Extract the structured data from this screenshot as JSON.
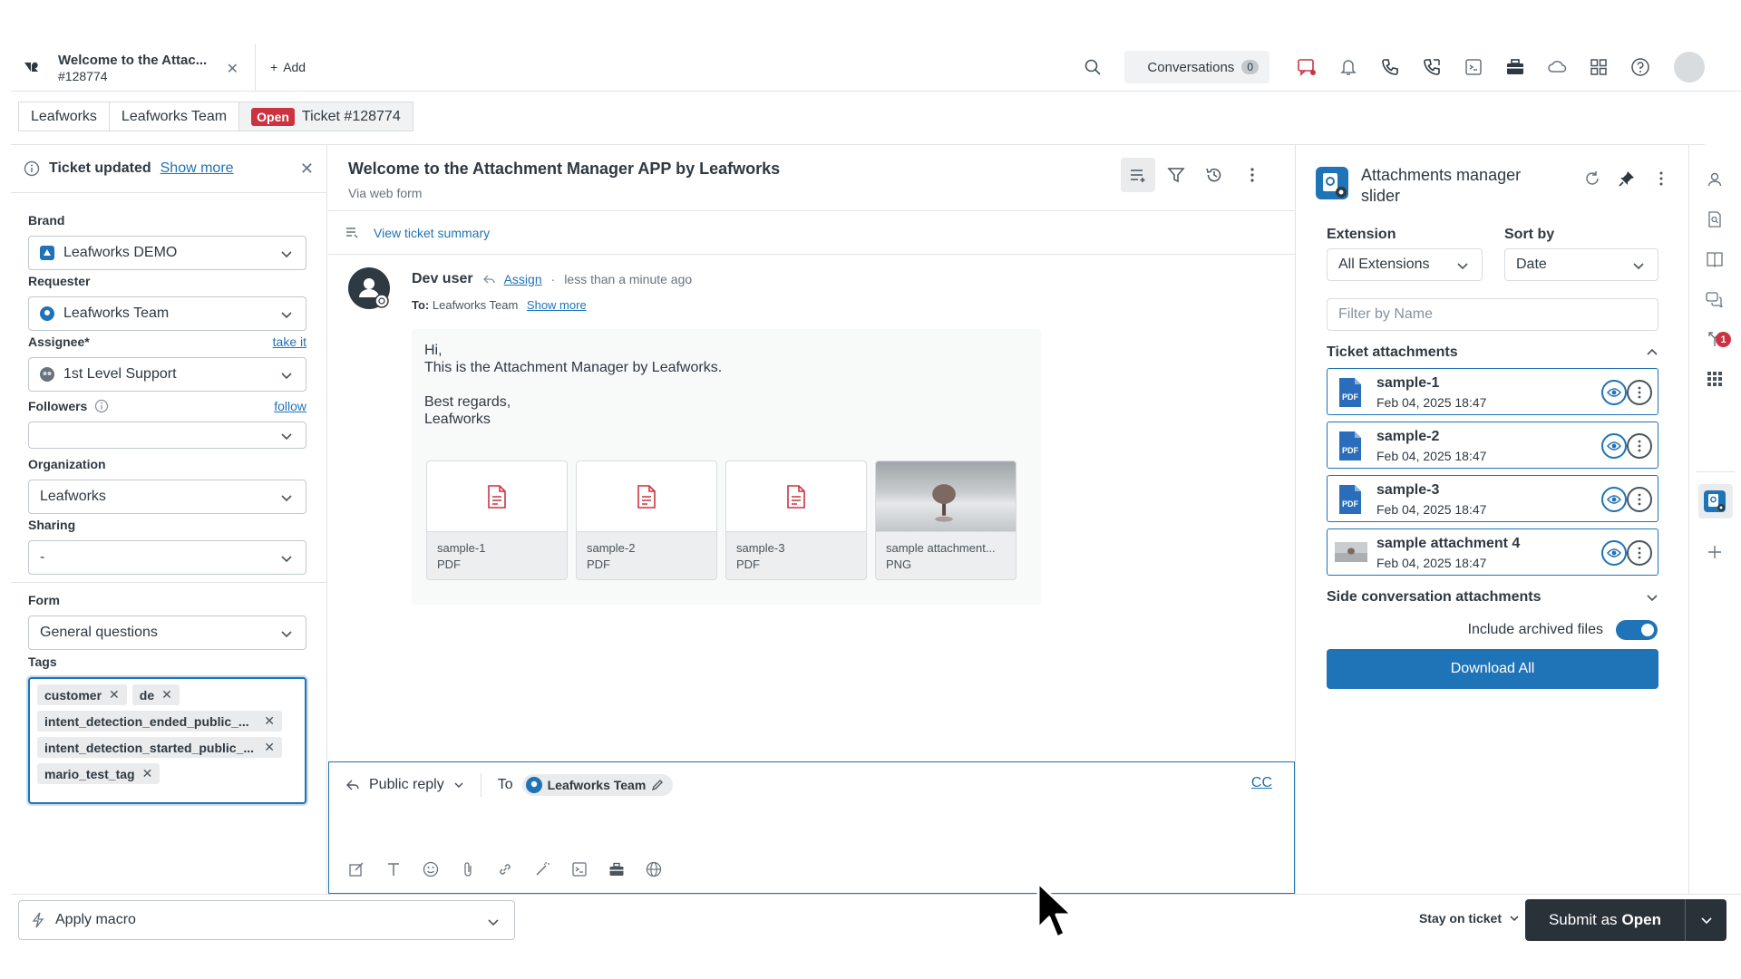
{
  "tab": {
    "title": "Welcome to the Attac...",
    "subtitle": "#128774",
    "add_label": "Add"
  },
  "topbar": {
    "conversations_label": "Conversations",
    "conversations_count": "0"
  },
  "breadcrumb": {
    "items": [
      "Leafworks",
      "Leafworks Team"
    ],
    "status": "Open",
    "ticket": "Ticket #128774"
  },
  "notice": {
    "text": "Ticket updated",
    "link": "Show more"
  },
  "fields": {
    "brand": {
      "label": "Brand",
      "value": "Leafworks DEMO"
    },
    "requester": {
      "label": "Requester",
      "value": "Leafworks Team"
    },
    "assignee": {
      "label": "Assignee*",
      "action": "take it",
      "value": "1st Level Support"
    },
    "followers": {
      "label": "Followers",
      "action": "follow",
      "value": ""
    },
    "organization": {
      "label": "Organization",
      "value": "Leafworks"
    },
    "sharing": {
      "label": "Sharing",
      "value": "-"
    },
    "form": {
      "label": "Form",
      "value": "General questions"
    },
    "tags": {
      "label": "Tags",
      "items": [
        "customer",
        "de",
        "intent_detection_ended_public_...",
        "intent_detection_started_public_...",
        "mario_test_tag"
      ]
    }
  },
  "bottom": {
    "macro_label": "Apply macro",
    "stay_label": "Stay on ticket",
    "submit_prefix": "Submit as",
    "submit_status": "Open"
  },
  "conversation": {
    "title": "Welcome to the Attachment Manager APP by Leafworks",
    "channel": "Via web form",
    "summary_link": "View ticket summary",
    "message": {
      "author": "Dev user",
      "assign": "Assign",
      "time": "less than a minute ago",
      "to_label": "To:",
      "to_value": "Leafworks Team",
      "show_more": "Show more",
      "lines": [
        "Hi,",
        "This is the Attachment Manager by Leafworks.",
        "",
        "Best regards,",
        "Leafworks"
      ],
      "attachments": [
        {
          "name": "sample-1",
          "type": "PDF"
        },
        {
          "name": "sample-2",
          "type": "PDF"
        },
        {
          "name": "sample-3",
          "type": "PDF"
        },
        {
          "name": "sample attachment...",
          "type": "PNG"
        }
      ]
    }
  },
  "composer": {
    "reply_type": "Public reply",
    "to_label": "To",
    "recipient": "Leafworks Team",
    "cc_label": "CC"
  },
  "app": {
    "title": "Attachments manager slider",
    "extension_label": "Extension",
    "extension_value": "All Extensions",
    "sort_label": "Sort by",
    "sort_value": "Date",
    "filter_placeholder": "Filter by Name",
    "ticket_section": "Ticket attachments",
    "files": [
      {
        "name": "sample-1",
        "date": "Feb 04, 2025 18:47",
        "kind": "pdf"
      },
      {
        "name": "sample-2",
        "date": "Feb 04, 2025 18:47",
        "kind": "pdf"
      },
      {
        "name": "sample-3",
        "date": "Feb 04, 2025 18:47",
        "kind": "pdf"
      },
      {
        "name": "sample attachment 4",
        "date": "Feb 04, 2025 18:47",
        "kind": "png"
      }
    ],
    "side_section": "Side conversation attachments",
    "archived_label": "Include archived files",
    "download_label": "Download All"
  },
  "rail": {
    "badge": "1"
  },
  "colors": {
    "accent": "#1f73b7",
    "danger": "#cc3340",
    "dark": "#293239"
  }
}
